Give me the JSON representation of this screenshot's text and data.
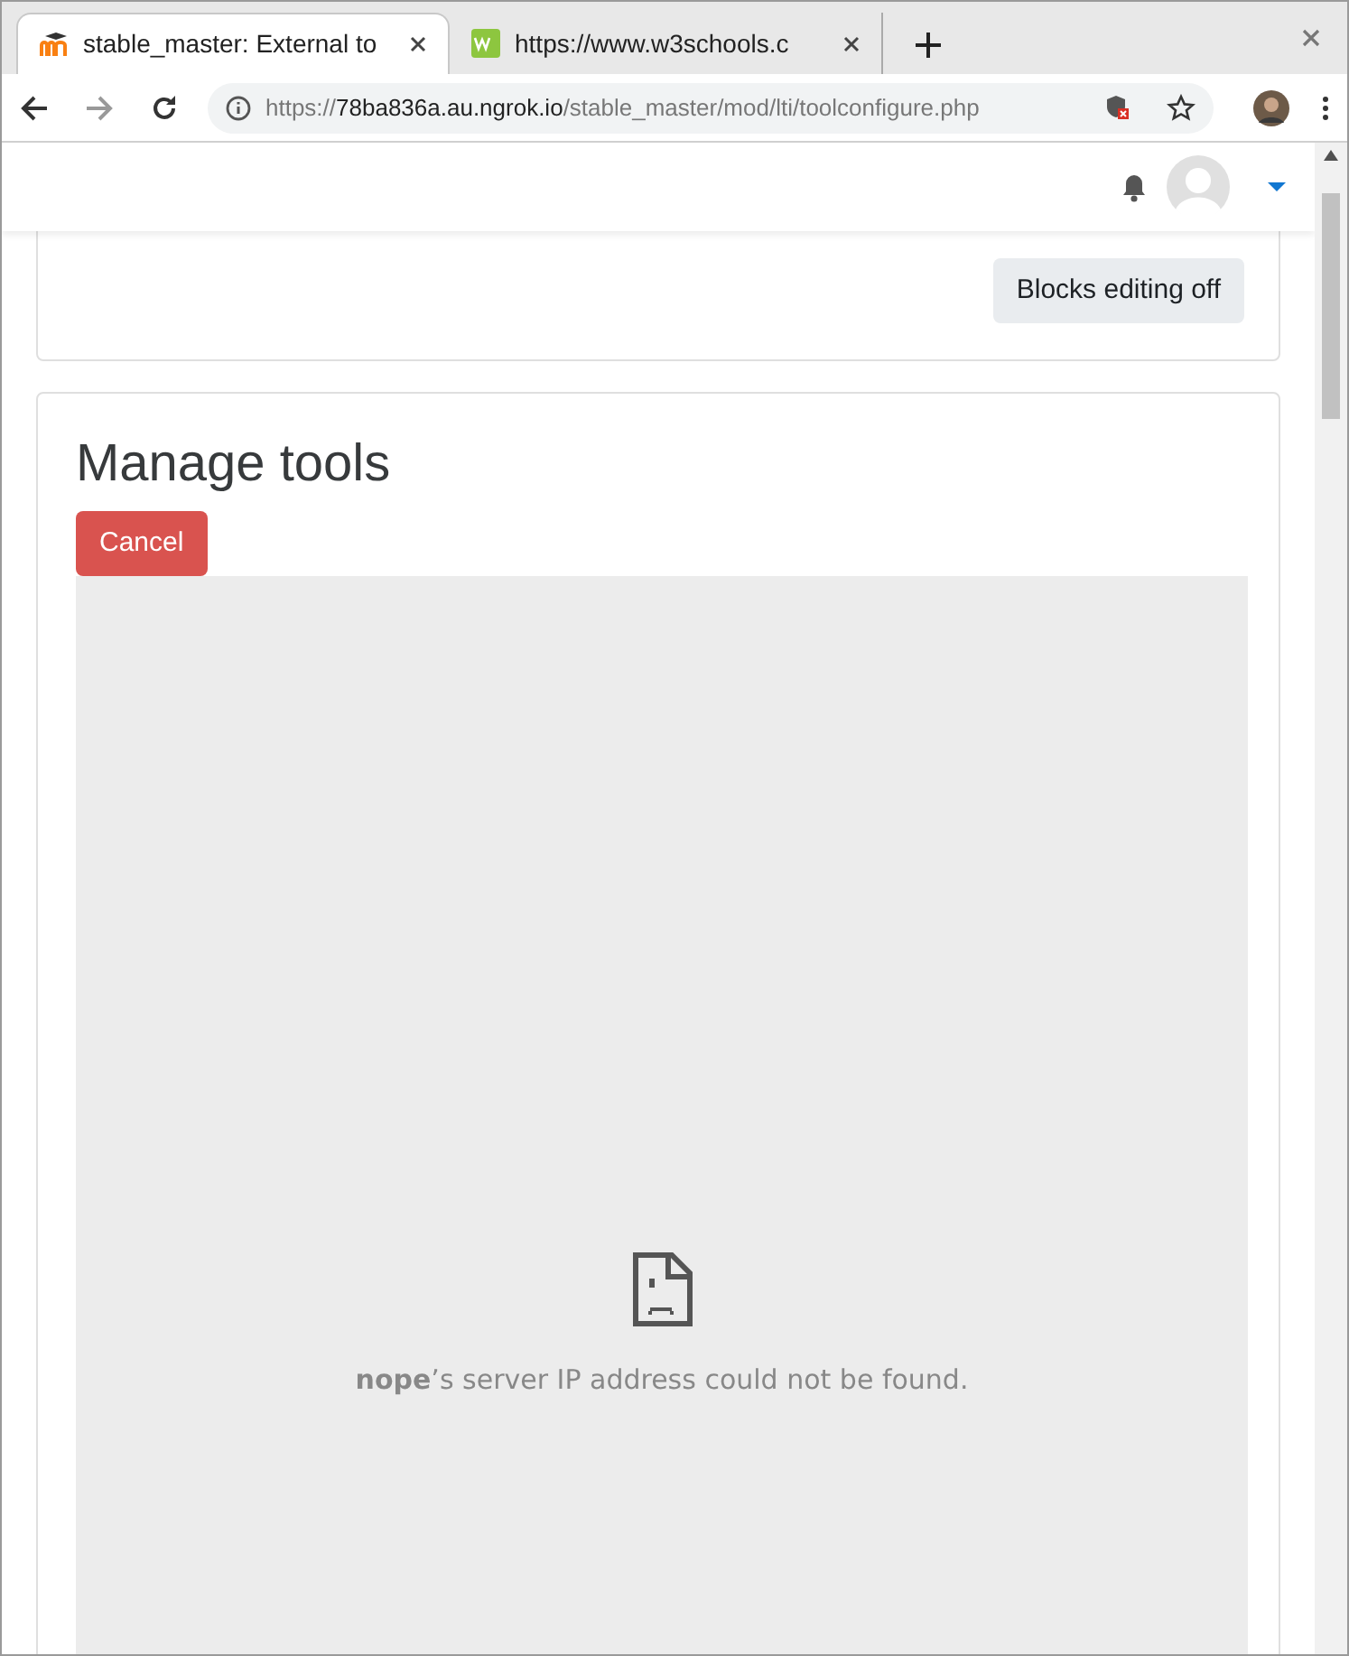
{
  "browser": {
    "tabs": [
      {
        "title": "stable_master: External to",
        "selected": true
      },
      {
        "title": "https://www.w3schools.c",
        "selected": false
      }
    ],
    "url": {
      "scheme": "https://",
      "host": "78ba836a.au.ngrok.io",
      "path": "/stable_master/mod/lti/toolconfigure.php"
    }
  },
  "blocks_button": "Blocks editing off",
  "heading": "Manage tools",
  "cancel_button": "Cancel",
  "frame_error": "**nope**’s server IP address could not be found."
}
